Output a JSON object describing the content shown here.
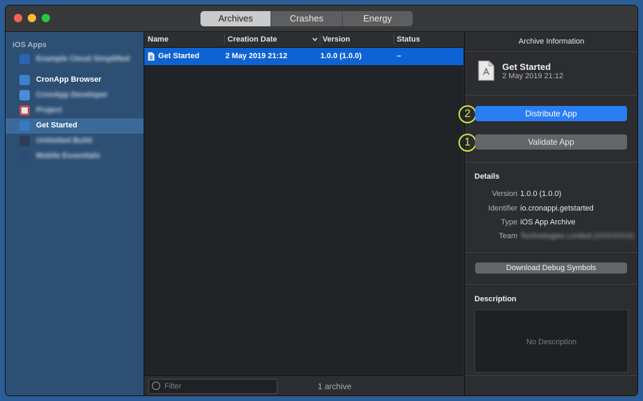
{
  "tabs": [
    "Archives",
    "Crashes",
    "Energy"
  ],
  "sidebar": {
    "section": "iOS Apps",
    "items": [
      {
        "label": "Example Cloud Simplified",
        "blurred": true,
        "selected": false,
        "icon_color": "#2b63b5"
      },
      {
        "label": "CronApp Browser",
        "blurred": false,
        "selected": false,
        "icon_color": "#3b82cc"
      },
      {
        "label": "CronApp Developer",
        "blurred": true,
        "selected": false,
        "icon_color": "#4c8bd6"
      },
      {
        "label": "Project",
        "blurred": true,
        "selected": false,
        "icon_color": "#c24b4b"
      },
      {
        "label": "Get Started",
        "blurred": false,
        "selected": true,
        "icon_color": "#3a78c2"
      },
      {
        "label": "Unlimited Build",
        "blurred": true,
        "selected": false,
        "icon_color": "#2f3c5a"
      },
      {
        "label": "Mobile Essentials",
        "blurred": true,
        "selected": false,
        "icon_color": "#2d4a78"
      }
    ]
  },
  "table": {
    "columns": [
      "Name",
      "Creation Date",
      "Version",
      "Status"
    ],
    "rows": [
      {
        "name": "Get Started",
        "date": "2 May 2019 21:12",
        "version": "1.0.0 (1.0.0)",
        "status": "–"
      }
    ],
    "filter_placeholder": "Filter",
    "count": "1 archive"
  },
  "inspector": {
    "title": "Archive Information",
    "archive_name": "Get Started",
    "archive_date": "2 May 2019 21:12",
    "distribute_label": "Distribute App",
    "validate_label": "Validate App",
    "badge_distribute": "2",
    "badge_validate": "1",
    "details_heading": "Details",
    "details": [
      {
        "key": "Version",
        "value": "1.0.0 (1.0.0)",
        "blurred": false
      },
      {
        "key": "Identifier",
        "value": "io.cronappi.getstarted",
        "blurred": false
      },
      {
        "key": "Type",
        "value": "iOS App Archive",
        "blurred": false
      },
      {
        "key": "Team",
        "value": "Technologies Limited (XXXXXXX)",
        "blurred": true
      }
    ],
    "download_label": "Download Debug Symbols",
    "description_heading": "Description",
    "description_placeholder": "No Description"
  },
  "colors": {
    "accent": "#2a7ef3",
    "selection": "#0e63d4",
    "annotation": "#d7e24a"
  }
}
